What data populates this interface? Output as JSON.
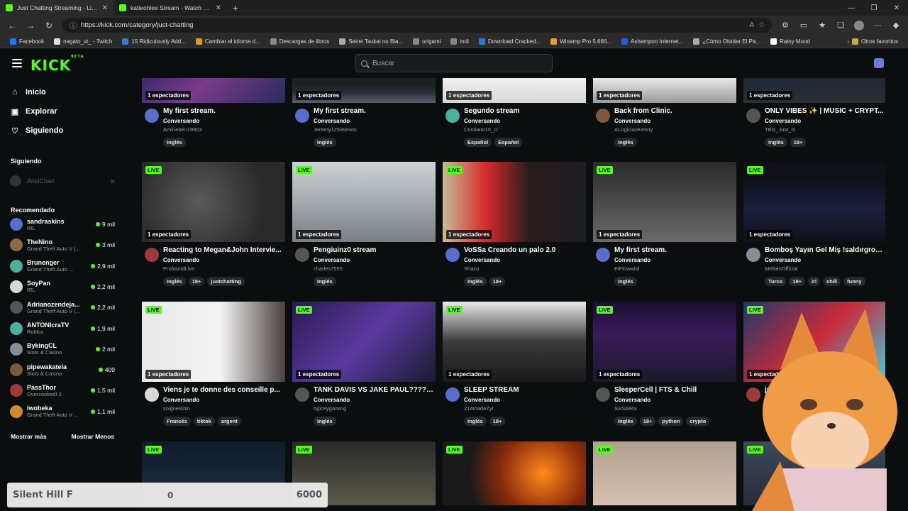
{
  "browser": {
    "tabs": [
      {
        "title": "Just Chatting Streaming - Live St",
        "active": true
      },
      {
        "title": "katieohlee Stream - Watch Live o",
        "active": false
      }
    ],
    "url": "https://kick.com/category/just-chatting",
    "bookmarks": [
      {
        "label": "Facebook",
        "color": "#1877f2"
      },
      {
        "label": "nagato_vt_ - Twitch",
        "color": "#ddd"
      },
      {
        "label": "15 Ridiculously Add...",
        "color": "#3a7ad0"
      },
      {
        "label": "Cambiar el idioma d...",
        "color": "#d0a02a"
      },
      {
        "label": "Descargas de libros",
        "color": "#888"
      },
      {
        "label": "Seirei Tsukai no Bla...",
        "color": "#aaa"
      },
      {
        "label": "origami",
        "color": "#888"
      },
      {
        "label": "indi",
        "color": "#888"
      },
      {
        "label": "Download Cracked...",
        "color": "#2a7ad0"
      },
      {
        "label": "Winamp Pro 5.666...",
        "color": "#e0a02a"
      },
      {
        "label": "Ashampoo Internet...",
        "color": "#2a5ad0"
      },
      {
        "label": "¿Cómo Olvidar El Pa...",
        "color": "#aaa"
      },
      {
        "label": "Rainy Mood",
        "color": "#fff"
      }
    ],
    "other_bookmarks": "Otros favoritos"
  },
  "header": {
    "logo": "KICK",
    "beta": "BETA",
    "search_placeholder": "Buscar"
  },
  "sidebar": {
    "nav": [
      {
        "label": "Inicio",
        "icon": "home-icon"
      },
      {
        "label": "Explorar",
        "icon": "compass-icon"
      },
      {
        "label": "Siguiendo",
        "icon": "heart-icon"
      }
    ],
    "following_heading": "Siguiendo",
    "following": [
      {
        "name": "AnsiChan"
      }
    ],
    "recommended_heading": "Recomendado",
    "recommended": [
      {
        "name": "sandraskins",
        "category": "IRL",
        "viewers": "9 mil"
      },
      {
        "name": "TheNino",
        "category": "Grand Theft Auto V (...",
        "viewers": "3 mil"
      },
      {
        "name": "Brunenger",
        "category": "Grand Theft Auto ...",
        "viewers": "2,9 mil"
      },
      {
        "name": "SoyPan",
        "category": "IRL",
        "viewers": "2,2 mil"
      },
      {
        "name": "Adrianozendeja...",
        "category": "Grand Theft Auto V (...",
        "viewers": "2,2 mil"
      },
      {
        "name": "ANTONIcraTV",
        "category": "Roblox",
        "viewers": "1,9 mil"
      },
      {
        "name": "BykingCL",
        "category": "Slots & Casino",
        "viewers": "2 mil"
      },
      {
        "name": "pipewakatela",
        "category": "Slots & Casino",
        "viewers": "409"
      },
      {
        "name": "PassThor",
        "category": "Overcooked! 2",
        "viewers": "1,5 mil"
      },
      {
        "name": "iwobeka",
        "category": "Grand Theft Auto V ...",
        "viewers": "1,1 mil"
      }
    ],
    "show_more": "Mostrar más",
    "show_less": "Mostrar Menos"
  },
  "streams": [
    {
      "title": "My first stream.",
      "category": "Conversando",
      "channel": "Amineben19903",
      "viewers": "1 espectadores",
      "tags": [
        "Inglés"
      ]
    },
    {
      "title": "My first stream.",
      "category": "Conversando",
      "channel": "Jeremy1253sesos",
      "viewers": "1 espectadores",
      "tags": [
        "Inglés"
      ]
    },
    {
      "title": "Segundo stream",
      "category": "Conversando",
      "channel": "Cristiano10_cr",
      "viewers": "1 espectadores",
      "tags": [
        "Español",
        "Español"
      ]
    },
    {
      "title": "Back from Clinic.",
      "category": "Conversando",
      "channel": "ALogicianKenny",
      "viewers": "1 espectadores",
      "tags": [
        "Inglés"
      ]
    },
    {
      "title": "ONLY VIBES ✨ | MUSIC + CRYPT...",
      "category": "Conversando",
      "channel": "TBG_Just_G",
      "viewers": "1 espectadores",
      "tags": [
        "Inglés",
        "18+"
      ]
    },
    {
      "title": "Reacting to Megan&John Intervie...",
      "category": "Conversando",
      "channel": "ProfoundLive",
      "viewers": "1 espectadores",
      "live": "LIVE",
      "tags": [
        "Inglés",
        "18+",
        "justchatting"
      ]
    },
    {
      "title": "Pengiuinz0 stream",
      "category": "Conversando",
      "channel": "charles7555",
      "viewers": "1 espectadores",
      "live": "LIVE",
      "tags": [
        "Inglés"
      ]
    },
    {
      "title": "VoSSa Creando un palo 2.0",
      "category": "Conversando",
      "channel": "Shacu",
      "viewers": "1 espectadores",
      "live": "LIVE",
      "tags": [
        "Inglés",
        "18+"
      ]
    },
    {
      "title": "My first stream.",
      "category": "Conversando",
      "channel": "ElFlowwiid",
      "viewers": "1 espectadores",
      "live": "LIVE",
      "tags": [
        "Inglés"
      ]
    },
    {
      "title": "Bomboş Yayın Gel Miş !saldırgrou...",
      "category": "Conversando",
      "channel": "MellainOfficial",
      "viewers": "1 espectadores",
      "live": "LIVE",
      "tags": [
        "Turco",
        "18+",
        "irl",
        "chill",
        "funny"
      ]
    },
    {
      "title": "Viens je te donne des conseille p...",
      "category": "Conversando",
      "channel": "soigne92izi",
      "viewers": "1 espectadores",
      "live": "LIVE",
      "tags": [
        "Francés",
        "tiktok",
        "argent"
      ]
    },
    {
      "title": "TANK DAVIS VS JAKE PAUL?????...",
      "category": "Conversando",
      "channel": "ogiceygaming",
      "viewers": "1 espectadores",
      "live": "LIVE",
      "tags": [
        "Inglés"
      ]
    },
    {
      "title": "SLEEP STREAM",
      "category": "Conversando",
      "channel": "214madeZyt",
      "viewers": "1 espectadores",
      "live": "LIVE",
      "tags": [
        "Inglés",
        "18+"
      ]
    },
    {
      "title": "SleeperCell | FTS & Chill",
      "category": "Conversando",
      "channel": "SixSikRix",
      "viewers": "1 espectadores",
      "live": "LIVE",
      "tags": [
        "Inglés",
        "18+",
        "python",
        "crypto"
      ]
    },
    {
      "title": "just s",
      "category": "Overc",
      "channel": "",
      "viewers": "1 espectadores",
      "live": "LIVE",
      "tags": []
    },
    {
      "live": "LIVE"
    },
    {
      "live": "LIVE"
    },
    {
      "live": "LIVE"
    },
    {
      "live": "LIVE"
    },
    {
      "live": "LIVE"
    }
  ],
  "overlay": {
    "game": "Silent Hill F",
    "current": "0",
    "goal": "6000"
  }
}
